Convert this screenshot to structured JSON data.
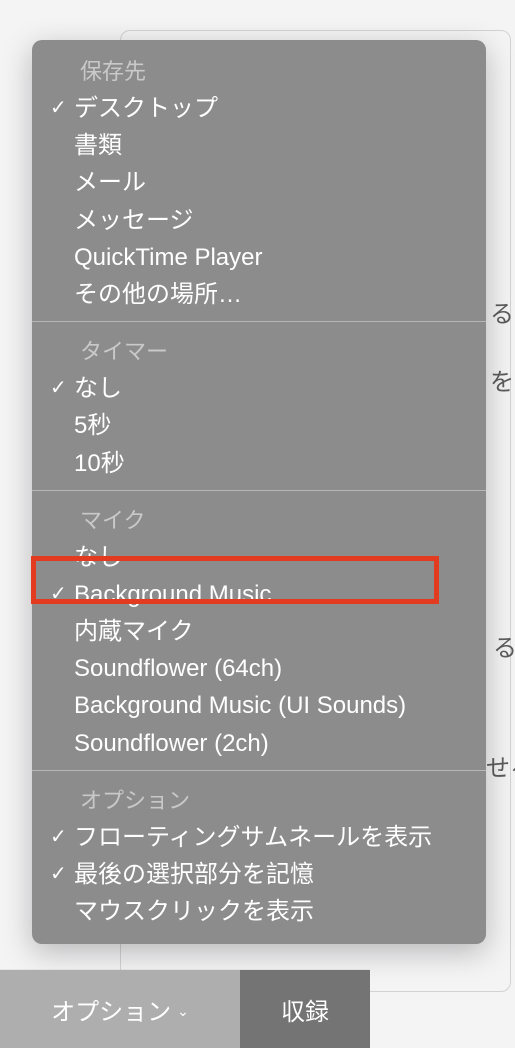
{
  "background_fragments": {
    "a": "るこ",
    "b": "を",
    "c": "る",
    "d": "せる"
  },
  "menu": {
    "sections": {
      "save_to": {
        "title": "保存先",
        "items": [
          {
            "label": "デスクトップ",
            "checked": true
          },
          {
            "label": "書類",
            "checked": false
          },
          {
            "label": "メール",
            "checked": false
          },
          {
            "label": "メッセージ",
            "checked": false
          },
          {
            "label": "QuickTime Player",
            "checked": false
          },
          {
            "label": "その他の場所…",
            "checked": false
          }
        ]
      },
      "timer": {
        "title": "タイマー",
        "items": [
          {
            "label": "なし",
            "checked": true
          },
          {
            "label": "5秒",
            "checked": false
          },
          {
            "label": "10秒",
            "checked": false
          }
        ]
      },
      "mic": {
        "title": "マイク",
        "items": [
          {
            "label": "なし",
            "checked": false
          },
          {
            "label": "Background Music",
            "checked": true
          },
          {
            "label": "内蔵マイク",
            "checked": false
          },
          {
            "label": "Soundflower (64ch)",
            "checked": false
          },
          {
            "label": "Background Music (UI Sounds)",
            "checked": false
          },
          {
            "label": "Soundflower (2ch)",
            "checked": false
          }
        ]
      },
      "options": {
        "title": "オプション",
        "items": [
          {
            "label": "フローティングサムネールを表示",
            "checked": true
          },
          {
            "label": "最後の選択部分を記憶",
            "checked": true
          },
          {
            "label": "マウスクリックを表示",
            "checked": false
          }
        ]
      }
    }
  },
  "toolbar": {
    "options_label": "オプション",
    "record_label": "収録"
  },
  "checkmark_glyph": "✓"
}
